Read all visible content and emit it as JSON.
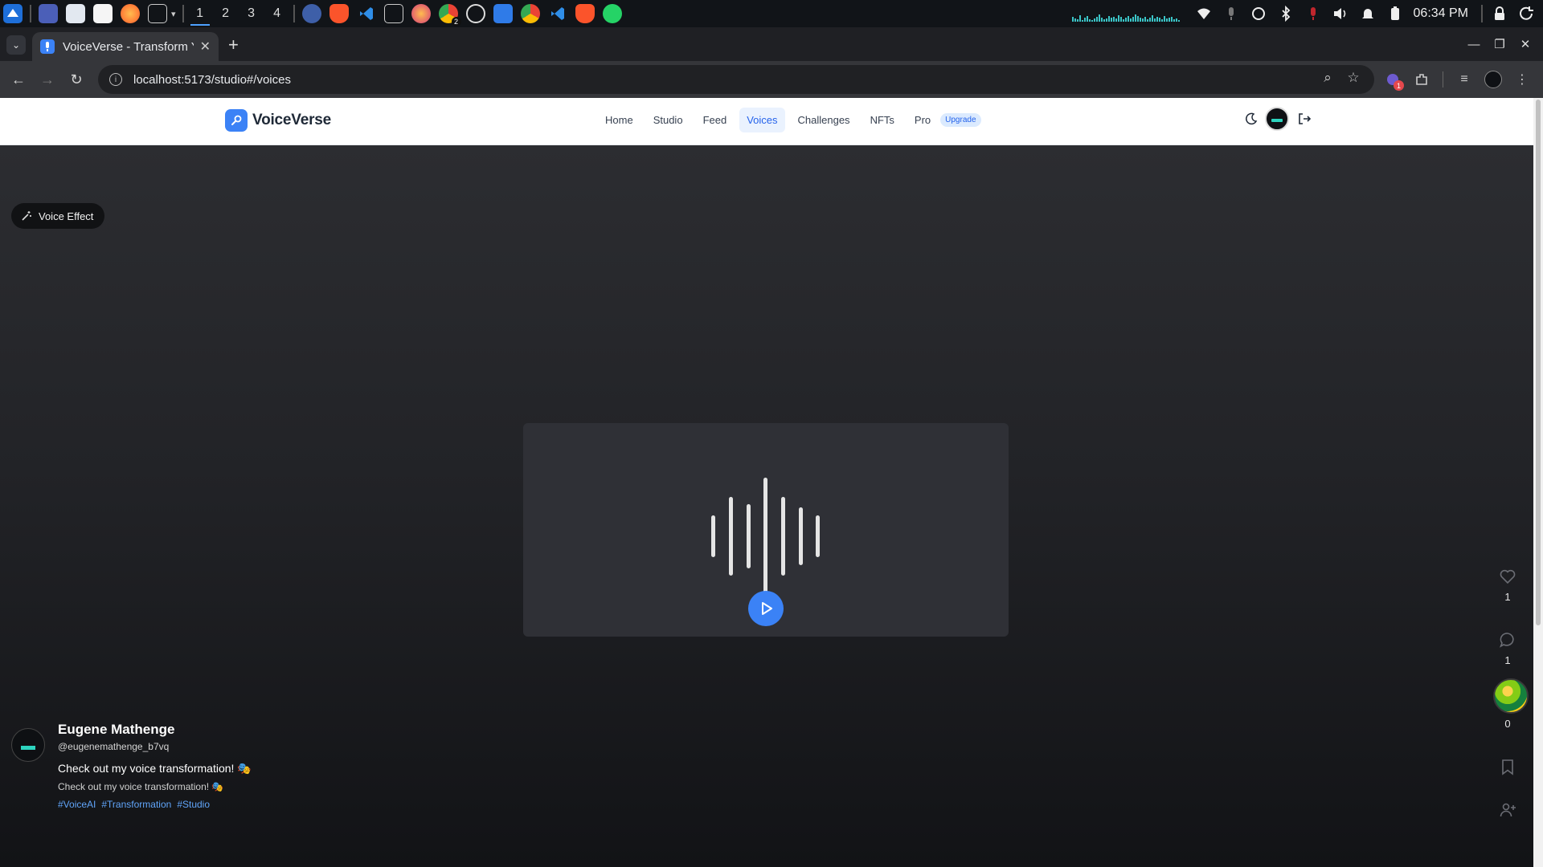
{
  "os": {
    "workspaces": [
      "1",
      "2",
      "3",
      "4"
    ],
    "active_workspace": "1",
    "chrome_badge": "2",
    "clock": "06:34 PM"
  },
  "browser": {
    "tab_title": "VoiceVerse - Transform Y",
    "url": "localhost:5173/studio#/voices",
    "extension_badge": "1"
  },
  "app": {
    "brand": "VoiceVerse",
    "nav": [
      {
        "label": "Home",
        "active": false
      },
      {
        "label": "Studio",
        "active": false
      },
      {
        "label": "Feed",
        "active": false
      },
      {
        "label": "Voices",
        "active": true
      },
      {
        "label": "Challenges",
        "active": false
      },
      {
        "label": "NFTs",
        "active": false
      },
      {
        "label": "Pro",
        "active": false
      }
    ],
    "upgrade_badge": "Upgrade"
  },
  "post": {
    "effect_label": "Voice Effect",
    "author_name": "Eugene Mathenge",
    "author_handle": "@eugenemathenge_b7vq",
    "caption": "Check out my voice transformation! 🎭",
    "description": "Check out my voice transformation! 🎭",
    "hashtags": [
      "#VoiceAI",
      "#Transformation",
      "#Studio"
    ],
    "likes": "1",
    "comments": "1",
    "shares": "0"
  },
  "colors": {
    "accent": "#3b82f6",
    "hashtag": "#60a5fa",
    "stage_top": "#2c2d31",
    "stage_bottom": "#121316"
  }
}
